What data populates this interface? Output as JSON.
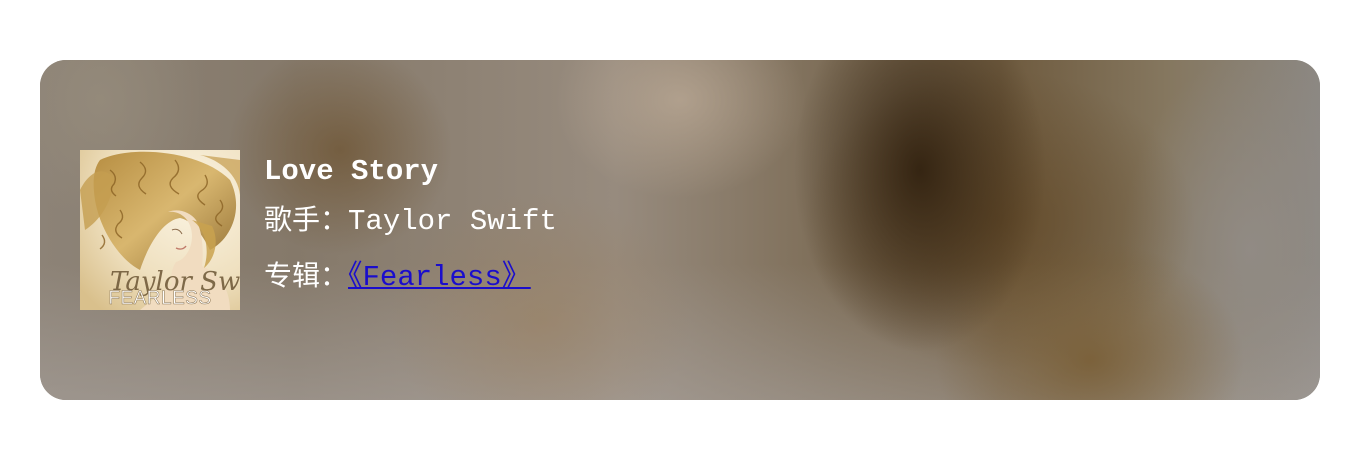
{
  "song": {
    "title": "Love Story",
    "artist_label": "歌手：",
    "artist": "Taylor Swift",
    "album_label": "专辑：",
    "album_link_text": "《Fearless》"
  },
  "cover": {
    "icon": "album-cover-image",
    "script_text": "Taylor Swift",
    "album_text": "FEARLESS"
  },
  "colors": {
    "link": "#1a0dcc",
    "text": "#ffffff"
  }
}
